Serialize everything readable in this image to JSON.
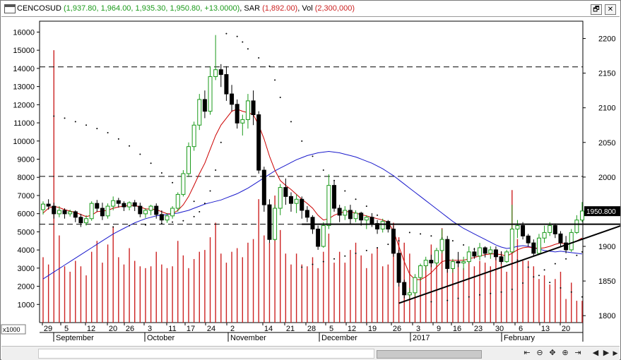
{
  "title": {
    "symbol": "CENCOSUD",
    "ohlc": "(1,937.80, 1,964.00, 1,935.30, 1,950.80, +13.0000)",
    "sar_label": "SAR",
    "sar": "(1,892.00)",
    "vol_label": "Vol",
    "vol": "(2,300,000)"
  },
  "window_buttons": {
    "restore": "🗗",
    "close": "✕"
  },
  "nav": {
    "home": "⇤",
    "zoom_out": "⊖",
    "pan": "✥",
    "zoom_in": "⊕",
    "end": "⇥",
    "prev": "◀",
    "play": "▶",
    "next": "▶"
  },
  "colors": {
    "up": "#1a9a1a",
    "down": "#000000",
    "volume": "#cc2222",
    "ma_fast": "#cc0000",
    "ma_slow": "#1a1acc",
    "sar": "#000000",
    "price_flag": "#000000"
  },
  "chart_data": {
    "type": "candlestick",
    "title": "CENCOSUD",
    "left_axis": {
      "label": "x1000",
      "ticks": [
        "16000",
        "15000",
        "14000",
        "13000",
        "12000",
        "11000",
        "10000",
        "9000",
        "8000",
        "7000",
        "6000",
        "5000",
        "4000",
        "3000",
        "2000",
        "1000"
      ],
      "ylim": [
        0,
        16600
      ]
    },
    "right_axis": {
      "ticks": [
        "2200",
        "2150",
        "2100",
        "2050",
        "2000",
        "1950",
        "1900",
        "1850",
        "1800"
      ],
      "ylim": [
        1790,
        2225
      ]
    },
    "last_price_label": "1950.800",
    "x_day_labels": [
      "29",
      "5",
      "12",
      "20",
      "26",
      "3",
      "11",
      "17",
      "24",
      "2",
      "14",
      "21",
      "28",
      "5",
      "12",
      "19",
      "26",
      "3",
      "9",
      "16",
      "23",
      "30",
      "6",
      "13",
      "20"
    ],
    "x_month_labels": [
      "September",
      "October",
      "November",
      "December",
      "2017",
      "February"
    ],
    "candles": [
      {
        "o": 1953,
        "h": 1965,
        "c": 1961,
        "l": 1946
      },
      {
        "o": 1961,
        "h": 1968,
        "c": 1958,
        "l": 1953
      },
      {
        "o": 1958,
        "h": 1963,
        "c": 1947,
        "l": 1940
      },
      {
        "o": 1947,
        "h": 1958,
        "c": 1952,
        "l": 1942
      },
      {
        "o": 1952,
        "h": 1955,
        "c": 1947,
        "l": 1940
      },
      {
        "o": 1947,
        "h": 1953,
        "c": 1950,
        "l": 1943
      },
      {
        "o": 1950,
        "h": 1952,
        "c": 1942,
        "l": 1935
      },
      {
        "o": 1942,
        "h": 1947,
        "c": 1934,
        "l": 1928
      },
      {
        "o": 1934,
        "h": 1945,
        "c": 1940,
        "l": 1930
      },
      {
        "o": 1940,
        "h": 1965,
        "c": 1962,
        "l": 1937
      },
      {
        "o": 1962,
        "h": 1967,
        "c": 1955,
        "l": 1950
      },
      {
        "o": 1955,
        "h": 1963,
        "c": 1944,
        "l": 1938
      },
      {
        "o": 1944,
        "h": 1962,
        "c": 1958,
        "l": 1940
      },
      {
        "o": 1958,
        "h": 1972,
        "c": 1966,
        "l": 1952
      },
      {
        "o": 1966,
        "h": 1970,
        "c": 1962,
        "l": 1956
      },
      {
        "o": 1962,
        "h": 1965,
        "c": 1957,
        "l": 1951
      },
      {
        "o": 1957,
        "h": 1965,
        "c": 1963,
        "l": 1952
      },
      {
        "o": 1963,
        "h": 1967,
        "c": 1958,
        "l": 1951
      },
      {
        "o": 1958,
        "h": 1963,
        "c": 1947,
        "l": 1942
      },
      {
        "o": 1947,
        "h": 1955,
        "c": 1952,
        "l": 1941
      },
      {
        "o": 1952,
        "h": 1960,
        "c": 1958,
        "l": 1945
      },
      {
        "o": 1958,
        "h": 1962,
        "c": 1946,
        "l": 1940
      },
      {
        "o": 1946,
        "h": 1952,
        "c": 1938,
        "l": 1934
      },
      {
        "o": 1938,
        "h": 1948,
        "c": 1944,
        "l": 1934
      },
      {
        "o": 1944,
        "h": 1958,
        "c": 1955,
        "l": 1940
      },
      {
        "o": 1955,
        "h": 1978,
        "c": 1975,
        "l": 1950
      },
      {
        "o": 1975,
        "h": 2010,
        "c": 2005,
        "l": 1972
      },
      {
        "o": 2005,
        "h": 2050,
        "c": 2044,
        "l": 2000
      },
      {
        "o": 2044,
        "h": 2080,
        "c": 2075,
        "l": 2038
      },
      {
        "o": 2075,
        "h": 2120,
        "c": 2112,
        "l": 2068
      },
      {
        "o": 2112,
        "h": 2125,
        "c": 2095,
        "l": 2085
      },
      {
        "o": 2095,
        "h": 2160,
        "c": 2145,
        "l": 2090
      },
      {
        "o": 2145,
        "h": 2205,
        "c": 2155,
        "l": 2140
      },
      {
        "o": 2155,
        "h": 2163,
        "c": 2148,
        "l": 2130
      },
      {
        "o": 2148,
        "h": 2160,
        "c": 2120,
        "l": 2110
      },
      {
        "o": 2120,
        "h": 2133,
        "c": 2105,
        "l": 2095
      },
      {
        "o": 2105,
        "h": 2112,
        "c": 2078,
        "l": 2070
      },
      {
        "o": 2078,
        "h": 2090,
        "c": 2083,
        "l": 2060
      },
      {
        "o": 2083,
        "h": 2120,
        "c": 2110,
        "l": 2070
      },
      {
        "o": 2110,
        "h": 2125,
        "c": 2090,
        "l": 2075
      },
      {
        "o": 2090,
        "h": 2095,
        "c": 2010,
        "l": 2005
      },
      {
        "o": 2010,
        "h": 2015,
        "c": 1960,
        "l": 1950
      },
      {
        "o": 1960,
        "h": 1968,
        "c": 1910,
        "l": 1905
      },
      {
        "o": 1910,
        "h": 1960,
        "c": 1955,
        "l": 1908
      },
      {
        "o": 1955,
        "h": 1990,
        "c": 1985,
        "l": 1945
      },
      {
        "o": 1985,
        "h": 1998,
        "c": 1972,
        "l": 1960
      },
      {
        "o": 1972,
        "h": 1978,
        "c": 1962,
        "l": 1950
      },
      {
        "o": 1962,
        "h": 1975,
        "c": 1968,
        "l": 1948
      },
      {
        "o": 1968,
        "h": 1972,
        "c": 1952,
        "l": 1940
      },
      {
        "o": 1952,
        "h": 1958,
        "c": 1942,
        "l": 1935
      },
      {
        "o": 1942,
        "h": 1945,
        "c": 1925,
        "l": 1918
      },
      {
        "o": 1925,
        "h": 1930,
        "c": 1900,
        "l": 1895
      },
      {
        "o": 1900,
        "h": 1935,
        "c": 1930,
        "l": 1898
      },
      {
        "o": 1930,
        "h": 2004,
        "c": 1988,
        "l": 1925
      },
      {
        "o": 1988,
        "h": 1995,
        "c": 1955,
        "l": 1950
      },
      {
        "o": 1955,
        "h": 1960,
        "c": 1945,
        "l": 1935
      },
      {
        "o": 1945,
        "h": 1958,
        "c": 1952,
        "l": 1938
      },
      {
        "o": 1952,
        "h": 1960,
        "c": 1940,
        "l": 1932
      },
      {
        "o": 1940,
        "h": 1952,
        "c": 1948,
        "l": 1935
      },
      {
        "o": 1948,
        "h": 1950,
        "c": 1938,
        "l": 1930
      },
      {
        "o": 1938,
        "h": 1945,
        "c": 1942,
        "l": 1925
      },
      {
        "o": 1942,
        "h": 1948,
        "c": 1933,
        "l": 1928
      },
      {
        "o": 1933,
        "h": 1938,
        "c": 1925,
        "l": 1918
      },
      {
        "o": 1925,
        "h": 1940,
        "c": 1936,
        "l": 1920
      },
      {
        "o": 1936,
        "h": 1938,
        "c": 1925,
        "l": 1920
      },
      {
        "o": 1925,
        "h": 1930,
        "c": 1890,
        "l": 1885
      },
      {
        "o": 1890,
        "h": 1895,
        "c": 1848,
        "l": 1842
      },
      {
        "o": 1848,
        "h": 1852,
        "c": 1830,
        "l": 1825
      },
      {
        "o": 1830,
        "h": 1840,
        "c": 1833,
        "l": 1825
      },
      {
        "o": 1833,
        "h": 1860,
        "c": 1855,
        "l": 1828
      },
      {
        "o": 1855,
        "h": 1875,
        "c": 1872,
        "l": 1850
      },
      {
        "o": 1872,
        "h": 1885,
        "c": 1880,
        "l": 1865
      },
      {
        "o": 1880,
        "h": 1888,
        "c": 1876,
        "l": 1870
      },
      {
        "o": 1876,
        "h": 1898,
        "c": 1894,
        "l": 1872
      },
      {
        "o": 1894,
        "h": 1925,
        "c": 1910,
        "l": 1890
      },
      {
        "o": 1910,
        "h": 1915,
        "c": 1868,
        "l": 1862
      },
      {
        "o": 1868,
        "h": 1882,
        "c": 1878,
        "l": 1862
      },
      {
        "o": 1878,
        "h": 1892,
        "c": 1876,
        "l": 1870
      },
      {
        "o": 1876,
        "h": 1885,
        "c": 1878,
        "l": 1866
      },
      {
        "o": 1878,
        "h": 1900,
        "c": 1892,
        "l": 1875
      },
      {
        "o": 1892,
        "h": 1898,
        "c": 1886,
        "l": 1882
      },
      {
        "o": 1886,
        "h": 1905,
        "c": 1898,
        "l": 1880
      },
      {
        "o": 1898,
        "h": 1900,
        "c": 1890,
        "l": 1884
      },
      {
        "o": 1890,
        "h": 1900,
        "c": 1895,
        "l": 1882
      },
      {
        "o": 1895,
        "h": 1900,
        "c": 1885,
        "l": 1880
      },
      {
        "o": 1885,
        "h": 1893,
        "c": 1878,
        "l": 1874
      },
      {
        "o": 1878,
        "h": 1895,
        "c": 1892,
        "l": 1876
      },
      {
        "o": 1892,
        "h": 1960,
        "c": 1925,
        "l": 1890
      },
      {
        "o": 1925,
        "h": 1938,
        "c": 1930,
        "l": 1912
      },
      {
        "o": 1930,
        "h": 1935,
        "c": 1915,
        "l": 1910
      },
      {
        "o": 1915,
        "h": 1918,
        "c": 1905,
        "l": 1900
      },
      {
        "o": 1905,
        "h": 1910,
        "c": 1890,
        "l": 1886
      },
      {
        "o": 1890,
        "h": 1918,
        "c": 1912,
        "l": 1888
      },
      {
        "o": 1912,
        "h": 1930,
        "c": 1920,
        "l": 1905
      },
      {
        "o": 1920,
        "h": 1935,
        "c": 1930,
        "l": 1915
      },
      {
        "o": 1930,
        "h": 1933,
        "c": 1918,
        "l": 1912
      },
      {
        "o": 1918,
        "h": 1922,
        "c": 1905,
        "l": 1900
      },
      {
        "o": 1905,
        "h": 1915,
        "c": 1895,
        "l": 1890
      },
      {
        "o": 1895,
        "h": 1925,
        "c": 1920,
        "l": 1892
      },
      {
        "o": 1920,
        "h": 1945,
        "c": 1938,
        "l": 1918
      },
      {
        "o": 1938,
        "h": 1964,
        "c": 1951,
        "l": 1935
      }
    ],
    "volumes_x1000": [
      3600,
      3200,
      15000,
      4800,
      3100,
      2800,
      3400,
      3100,
      2600,
      3900,
      4500,
      3300,
      4300,
      5300,
      3600,
      3200,
      4100,
      3400,
      3100,
      3000,
      3100,
      3900,
      3200,
      3000,
      3100,
      4500,
      3700,
      3000,
      3500,
      3900,
      4000,
      4700,
      5500,
      3800,
      3300,
      3900,
      4100,
      3600,
      4400,
      4600,
      6800,
      4800,
      4400,
      7000,
      5100,
      3800,
      3200,
      3800,
      3200,
      3100,
      3600,
      3000,
      3900,
      4900,
      3300,
      3900,
      3300,
      4000,
      4400,
      3700,
      3000,
      3800,
      4100,
      3100,
      3200,
      5500,
      4700,
      4400,
      3800,
      2500,
      2700,
      3100,
      4300,
      3300,
      5200,
      4100,
      3400,
      3400,
      3000,
      3600,
      3100,
      3400,
      3300,
      3100,
      3900,
      3900,
      2800,
      7300,
      4600,
      3400,
      3400,
      3100,
      2400,
      2600,
      2100,
      2400,
      2800,
      1300,
      2200,
      1200,
      1200
    ],
    "ma_fast": [
      1948,
      1955,
      1958,
      1956,
      1953,
      1951,
      1949,
      1946,
      1943,
      1945,
      1950,
      1951,
      1952,
      1955,
      1957,
      1958,
      1959,
      1959,
      1957,
      1954,
      1954,
      1953,
      1950,
      1947,
      1947,
      1952,
      1960,
      1972,
      1988,
      2005,
      2020,
      2040,
      2060,
      2075,
      2085,
      2095,
      2098,
      2095,
      2093,
      2090,
      2075,
      2055,
      2030,
      2010,
      1995,
      1988,
      1982,
      1975,
      1968,
      1962,
      1955,
      1945,
      1938,
      1940,
      1945,
      1948,
      1950,
      1950,
      1948,
      1946,
      1944,
      1942,
      1940,
      1938,
      1935,
      1922,
      1900,
      1878,
      1860,
      1852,
      1852,
      1856,
      1862,
      1870,
      1878,
      1880,
      1880,
      1880,
      1880,
      1882,
      1884,
      1886,
      1888,
      1889,
      1889,
      1888,
      1886,
      1890,
      1895,
      1898,
      1899,
      1898,
      1897,
      1898,
      1900,
      1903,
      1905,
      1903,
      1904,
      1908,
      1912
    ],
    "ma_slow": [
      1853,
      1858,
      1863,
      1868,
      1873,
      1878,
      1883,
      1888,
      1893,
      1898,
      1903,
      1908,
      1913,
      1918,
      1922,
      1926,
      1930,
      1934,
      1937,
      1940,
      1942,
      1944,
      1945,
      1946,
      1947,
      1948,
      1950,
      1952,
      1955,
      1958,
      1961,
      1963,
      1965,
      1967,
      1970,
      1973,
      1976,
      1980,
      1984,
      1989,
      1994,
      1999,
      2004,
      2009,
      2013,
      2017,
      2021,
      2025,
      2028,
      2031,
      2033,
      2035,
      2036,
      2037,
      2036,
      2035,
      2033,
      2031,
      2029,
      2026,
      2023,
      2020,
      2016,
      2012,
      2007,
      2002,
      1996,
      1990,
      1984,
      1978,
      1972,
      1966,
      1960,
      1954,
      1948,
      1942,
      1936,
      1931,
      1926,
      1922,
      1918,
      1914,
      1910,
      1906,
      1902,
      1899,
      1897,
      1898,
      1900,
      1901,
      1900,
      1898,
      1896,
      1894,
      1893,
      1892,
      1893,
      1892,
      1891,
      1890,
      1889
    ],
    "sar_points": [
      [
        2,
        2088
      ],
      [
        4,
        2085
      ],
      [
        6,
        2080
      ],
      [
        8,
        2075
      ],
      [
        10,
        2070
      ],
      [
        12,
        2064
      ],
      [
        14,
        2055
      ],
      [
        16,
        2045
      ],
      [
        18,
        2033
      ],
      [
        20,
        2020
      ],
      [
        22,
        2006
      ],
      [
        24,
        1992
      ],
      [
        26,
        1978
      ],
      [
        28,
        1965
      ],
      [
        13,
        1928
      ],
      [
        16,
        1930
      ],
      [
        19,
        1931
      ],
      [
        22,
        1933
      ],
      [
        24,
        1935
      ],
      [
        26,
        1937
      ],
      [
        28,
        1943
      ],
      [
        29,
        1950
      ],
      [
        30,
        1962
      ],
      [
        31,
        1980
      ],
      [
        32,
        2010
      ],
      [
        33,
        2050
      ],
      [
        34,
        2207
      ],
      [
        36,
        2203
      ],
      [
        37,
        2195
      ],
      [
        38,
        2185
      ],
      [
        40,
        2172
      ],
      [
        42,
        2160
      ],
      [
        43,
        2140
      ],
      [
        44,
        2115
      ],
      [
        46,
        2080
      ],
      [
        48,
        2052
      ],
      [
        50,
        2030
      ],
      [
        52,
        2010
      ],
      [
        54,
        1995
      ],
      [
        56,
        1980
      ],
      [
        58,
        1968
      ],
      [
        60,
        1958
      ],
      [
        62,
        1945
      ],
      [
        48,
        1870
      ],
      [
        50,
        1874
      ],
      [
        52,
        1878
      ],
      [
        54,
        1882
      ],
      [
        56,
        1886
      ],
      [
        58,
        1890
      ],
      [
        60,
        1894
      ],
      [
        62,
        1898
      ],
      [
        64,
        1903
      ],
      [
        66,
        1908
      ],
      [
        68,
        1920
      ],
      [
        70,
        1918
      ],
      [
        72,
        1915
      ],
      [
        74,
        1912
      ],
      [
        76,
        1908
      ],
      [
        78,
        1902
      ],
      [
        80,
        1896
      ],
      [
        82,
        1891
      ],
      [
        84,
        1888
      ],
      [
        86,
        1885
      ],
      [
        88,
        1880
      ],
      [
        90,
        1870
      ],
      [
        92,
        1858
      ],
      [
        94,
        1848
      ],
      [
        96,
        1840
      ],
      [
        98,
        1834
      ],
      [
        100,
        1827
      ],
      [
        72,
        1820
      ],
      [
        75,
        1822
      ],
      [
        77,
        1825
      ],
      [
        79,
        1827
      ],
      [
        81,
        1830
      ],
      [
        83,
        1832
      ],
      [
        85,
        1834
      ],
      [
        87,
        1838
      ],
      [
        89,
        1847
      ],
      [
        91,
        1856
      ],
      [
        93,
        1866
      ],
      [
        95,
        1875
      ],
      [
        97,
        1882
      ],
      [
        99,
        1887
      ],
      [
        100,
        1892
      ]
    ],
    "h_dashed_levels": [
      2159,
      2001,
      1932
    ],
    "trendlines": [
      {
        "from": [
          66,
          1818
        ],
        "to": [
          108,
          1932
        ]
      },
      {
        "from": [
          48,
          1932
        ],
        "to": [
          108,
          1932
        ]
      }
    ]
  }
}
